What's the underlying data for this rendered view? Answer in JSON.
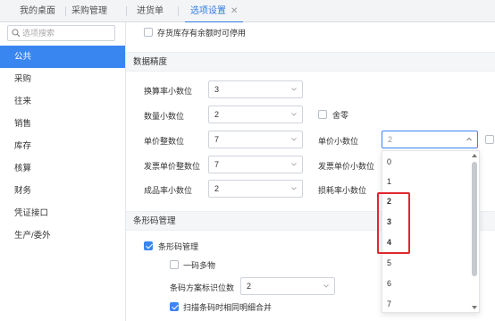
{
  "tabs": [
    {
      "label": "我的桌面"
    },
    {
      "label": "采购管理"
    },
    {
      "label": "进货单"
    },
    {
      "label": "选项设置",
      "close": "✕"
    }
  ],
  "sidebar": {
    "search_placeholder": "选项搜索",
    "items": [
      {
        "label": "公共"
      },
      {
        "label": "采购"
      },
      {
        "label": "往来"
      },
      {
        "label": "销售"
      },
      {
        "label": "库存"
      },
      {
        "label": "核算"
      },
      {
        "label": "财务"
      },
      {
        "label": "凭证接口"
      },
      {
        "label": "生产/委外"
      }
    ]
  },
  "main": {
    "top_checkbox": {
      "label": "存货库存有余额时可停用",
      "checked": false
    },
    "precision_section": {
      "title": "数据精度",
      "rows": [
        {
          "label": "换算率小数位",
          "value": "3"
        },
        {
          "label": "数量小数位",
          "value": "2",
          "extra_checkbox": "舍零"
        },
        {
          "label": "单价整数位",
          "value": "7",
          "right_label": "单价小数位",
          "right_value": "2"
        },
        {
          "label": "发票单价整数位",
          "value": "7",
          "right_label": "发票单价小数位"
        },
        {
          "label": "成品率小数位",
          "value": "2",
          "right_label": "损耗率小数位"
        }
      ]
    },
    "barcode_section": {
      "title": "条形码管理",
      "barcode_mgmt": {
        "label": "条形码管理",
        "checked": true
      },
      "multi_item": {
        "label": "一码多物",
        "checked": false
      },
      "scheme_digits": {
        "label": "条码方案标识位数",
        "value": "2"
      },
      "merge_detail": {
        "label": "扫描条码时相同明细合并",
        "checked": true
      }
    }
  },
  "dropdown": {
    "options": [
      "0",
      "1",
      "2",
      "3",
      "4",
      "5",
      "6",
      "7"
    ],
    "bold_options": [
      "2",
      "3",
      "4"
    ],
    "highlighted_options": [
      "2",
      "3",
      "4"
    ]
  },
  "colors": {
    "accent": "#3a86f0",
    "highlight": "#e0282e"
  }
}
